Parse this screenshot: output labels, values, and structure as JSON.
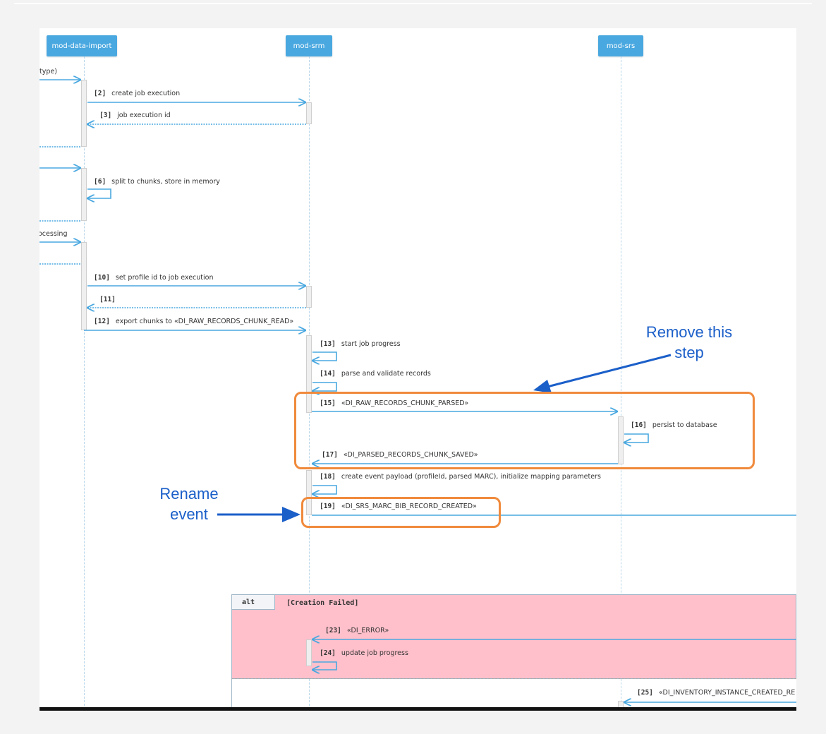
{
  "participants": [
    {
      "name": "mod-data-import"
    },
    {
      "name": "mod-srm"
    },
    {
      "name": "mod-srs"
    }
  ],
  "left_labels": {
    "type": "type)",
    "processing": "ocessing"
  },
  "messages": [
    {
      "num": "[2]",
      "text": "create job execution"
    },
    {
      "num": "[3]",
      "text": "job execution id"
    },
    {
      "num": "[6]",
      "text": "split to chunks, store in memory"
    },
    {
      "num": "[10]",
      "text": "set profile id to job execution"
    },
    {
      "num": "[11]",
      "text": ""
    },
    {
      "num": "[12]",
      "text": "export chunks to «DI_RAW_RECORDS_CHUNK_READ»"
    },
    {
      "num": "[13]",
      "text": "start job progress"
    },
    {
      "num": "[14]",
      "text": "parse and validate records"
    },
    {
      "num": "[15]",
      "text": "«DI_RAW_RECORDS_CHUNK_PARSED»"
    },
    {
      "num": "[16]",
      "text": "persist to database"
    },
    {
      "num": "[17]",
      "text": "«DI_PARSED_RECORDS_CHUNK_SAVED»"
    },
    {
      "num": "[18]",
      "text": "create event payload (profileId, parsed MARC), initialize mapping parameters"
    },
    {
      "num": "[19]",
      "text": "«DI_SRS_MARC_BIB_RECORD_CREATED»"
    },
    {
      "num": "[23]",
      "text": "«DI_ERROR»"
    },
    {
      "num": "[24]",
      "text": "update job progress"
    },
    {
      "num": "[25]",
      "text": "«DI_INVENTORY_INSTANCE_CREATED_RE"
    }
  ],
  "alt": {
    "keyword": "alt",
    "guard": "[Creation Failed]"
  },
  "annotations": {
    "remove_line1": "Remove this",
    "remove_line2": "step",
    "rename_line1": "Rename",
    "rename_line2": "event"
  },
  "colors": {
    "participant": "#4aa8e0",
    "arrow": "#4aa8e0",
    "highlight": "#f08a3c",
    "annotation": "#1b5fc9",
    "alt_background": "#ffc0cb"
  }
}
